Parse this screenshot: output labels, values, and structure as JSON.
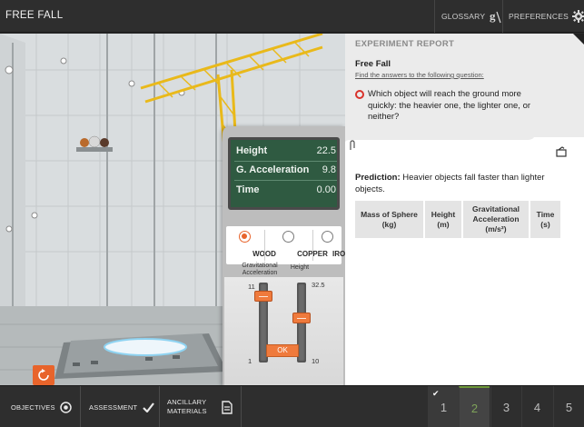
{
  "app": {
    "title": "FREE FALL"
  },
  "topbar": {
    "glossary_label": "GLOSSARY",
    "preferences_label": "PREFERENCES"
  },
  "readout": {
    "rows": [
      {
        "label": "Height",
        "value": "22.5"
      },
      {
        "label": "G. Acceleration",
        "value": "9.8"
      },
      {
        "label": "Time",
        "value": "0.00"
      }
    ]
  },
  "materials": {
    "options": [
      "WOOD",
      "COPPER",
      "IRON"
    ],
    "selected": "WOOD"
  },
  "sliders": {
    "gravity_label": "Gravitational Acceleration",
    "height_label": "Height",
    "gravity_max": "11",
    "gravity_min": "1",
    "gravity_value_fraction": 0.88,
    "height_max": "32.5",
    "height_min": "10",
    "height_value_fraction": 0.56,
    "ok_label": "OK"
  },
  "report": {
    "heading": "EXPERIMENT REPORT",
    "subtitle": "Free Fall",
    "link": "Find the answers to the following question:",
    "question": "Which object will reach the ground more quickly: the heavier one, the lighter one, or neither?",
    "prediction_label": "Prediction:",
    "prediction_text": "Heavier objects fall faster than lighter objects.",
    "table_headers": [
      "Mass of Sphere (kg)",
      "Height (m)",
      "Gravitational Acceleration",
      "Time (s)"
    ],
    "accel_unit": "(m/s²)"
  },
  "bottombar": {
    "objectives_label": "OBJECTIVES",
    "assessment_label": "ASSESSMENT",
    "ancillary_label_1": "ANCILLARY",
    "ancillary_label_2": "MATERIALS",
    "steps": [
      "1",
      "2",
      "3",
      "4",
      "5"
    ],
    "completed_step": "1",
    "current_step": "2"
  },
  "colors": {
    "accent": "#e8642b",
    "readout_bg": "#2f5a41",
    "step_active": "#6f9a3a",
    "question_ring": "#d9322b"
  }
}
